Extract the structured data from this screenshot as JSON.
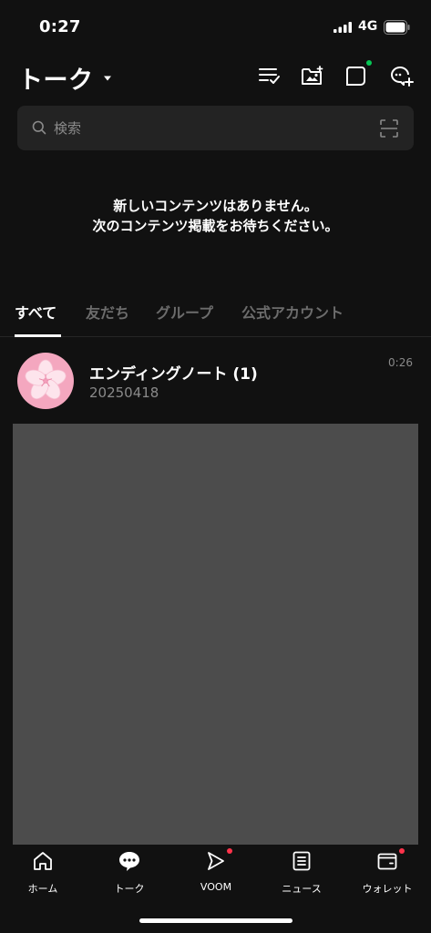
{
  "status_bar": {
    "time": "0:27",
    "network": "4G"
  },
  "header": {
    "title": "トーク"
  },
  "search": {
    "placeholder": "検索"
  },
  "notice": {
    "line1": "新しいコンテンツはありません。",
    "line2": "次のコンテンツ掲載をお待ちください。"
  },
  "tabs": [
    {
      "label": "すべて",
      "active": true
    },
    {
      "label": "友だち",
      "active": false
    },
    {
      "label": "グループ",
      "active": false
    },
    {
      "label": "公式アカウント",
      "active": false
    }
  ],
  "chats": [
    {
      "name": "エンディングノート (1)",
      "preview": "20250418",
      "time": "0:26"
    }
  ],
  "bottom_nav": [
    {
      "label": "ホーム",
      "icon": "home-icon"
    },
    {
      "label": "トーク",
      "icon": "talk-icon"
    },
    {
      "label": "VOOM",
      "icon": "voom-icon"
    },
    {
      "label": "ニュース",
      "icon": "news-icon"
    },
    {
      "label": "ウォレット",
      "icon": "wallet-icon"
    }
  ],
  "colors": {
    "background": "#111111",
    "search_bg": "#232323",
    "notification_green": "#06c755",
    "notification_red": "#ff334b",
    "avatar_pink": "#f4a7bf",
    "ad_gray": "#4c4c4c"
  }
}
